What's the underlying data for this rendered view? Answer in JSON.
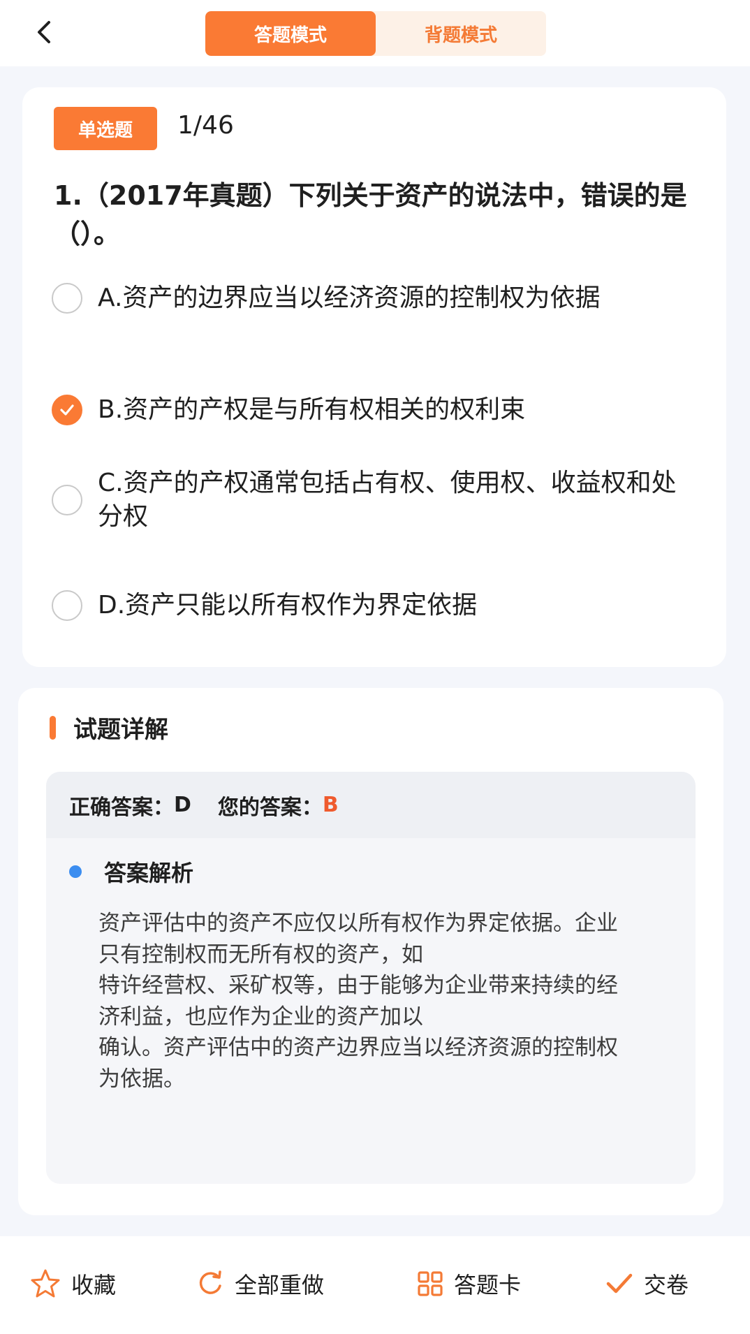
{
  "header": {
    "back_icon": "chevron-left-icon",
    "tabs": [
      {
        "label": "答题模式",
        "active": true
      },
      {
        "label": "背题模式",
        "active": false
      }
    ]
  },
  "question": {
    "type_badge": "单选题",
    "counter": "1/46",
    "text": "1.（2017年真题）下列关于资产的说法中，错误的是（）。",
    "options": [
      {
        "text": "A.资产的边界应当以经济资源的控制权为依据",
        "selected": false
      },
      {
        "text": "B.资产的产权是与所有权相关的权利束",
        "selected": true
      },
      {
        "text": "C.资产的产权通常包括占有权、使用权、收益权和处分权",
        "selected": false
      },
      {
        "text": "D.资产只能以所有权作为界定依据",
        "selected": false
      }
    ]
  },
  "explanation": {
    "title": "试题详解",
    "correct_label": "正确答案：",
    "correct_value": "D",
    "your_label": "您的答案：",
    "your_value": "B",
    "analysis_title": "答案解析",
    "analysis_text": "资产评估中的资产不应仅以所有权作为界定依据。企业只有控制权而无所有权的资产，如\n特许经营权、采矿权等，由于能够为企业带来持续的经济利益，也应作为企业的资产加以\n确认。资产评估中的资产边界应当以经济资源的控制权为依据。"
  },
  "bottom_bar": [
    {
      "label": "收藏",
      "icon": "star-icon"
    },
    {
      "label": "全部重做",
      "icon": "refresh-icon"
    },
    {
      "label": "答题卡",
      "icon": "grid-icon"
    },
    {
      "label": "交卷",
      "icon": "check-icon"
    }
  ],
  "colors": {
    "accent": "#fa7a34",
    "wrong_answer": "#ef5a2d",
    "analysis_dot": "#3b8df0"
  }
}
